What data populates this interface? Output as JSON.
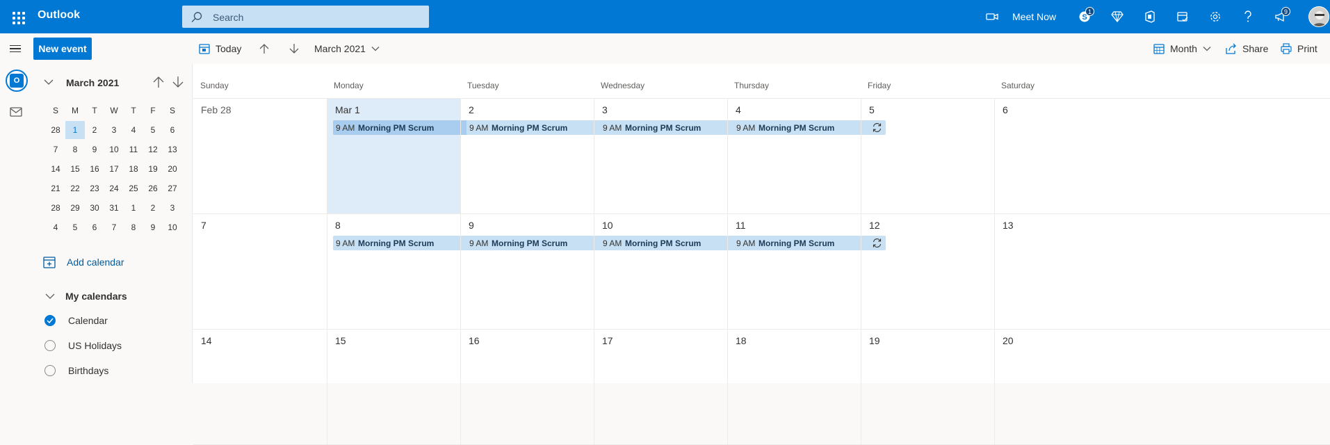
{
  "app": {
    "title": "Outlook"
  },
  "search": {
    "placeholder": "Search"
  },
  "topbar": {
    "meet_now": "Meet Now",
    "skype_badge": "1",
    "notifications_badge": "9"
  },
  "commands": {
    "new_event": "New event",
    "today": "Today",
    "period": "March 2021",
    "view": "Month",
    "share": "Share",
    "print": "Print"
  },
  "mini_calendar": {
    "title": "March 2021",
    "weekdays": [
      "S",
      "M",
      "T",
      "W",
      "T",
      "F",
      "S"
    ],
    "weeks": [
      [
        "28",
        "1",
        "2",
        "3",
        "4",
        "5",
        "6"
      ],
      [
        "7",
        "8",
        "9",
        "10",
        "11",
        "12",
        "13"
      ],
      [
        "14",
        "15",
        "16",
        "17",
        "18",
        "19",
        "20"
      ],
      [
        "21",
        "22",
        "23",
        "24",
        "25",
        "26",
        "27"
      ],
      [
        "28",
        "29",
        "30",
        "31",
        "1",
        "2",
        "3"
      ],
      [
        "4",
        "5",
        "6",
        "7",
        "8",
        "9",
        "10"
      ]
    ],
    "selected": "1"
  },
  "sidebar": {
    "add_calendar": "Add calendar",
    "my_calendars": "My calendars",
    "calendars": [
      {
        "label": "Calendar",
        "checked": true
      },
      {
        "label": "US Holidays",
        "checked": false
      },
      {
        "label": "Birthdays",
        "checked": false
      }
    ]
  },
  "calendar": {
    "weekdays": [
      "Sunday",
      "Monday",
      "Tuesday",
      "Wednesday",
      "Thursday",
      "Friday",
      "Saturday"
    ],
    "weeks": [
      [
        "Feb 28",
        "Mar 1",
        "2",
        "3",
        "4",
        "5",
        "6"
      ],
      [
        "7",
        "8",
        "9",
        "10",
        "11",
        "12",
        "13"
      ],
      [
        "14",
        "15",
        "16",
        "17",
        "18",
        "19",
        "20"
      ]
    ],
    "event": {
      "time": "9 AM",
      "subject": "Morning PM Scrum"
    }
  },
  "colors": {
    "brand": "#0078d4",
    "event_bg": "#c7e0f4",
    "today_bg": "#deecf9"
  }
}
